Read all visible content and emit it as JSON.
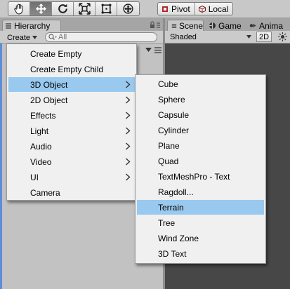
{
  "toolbar": {
    "tools": [
      {
        "icon": "hand-icon",
        "active": false
      },
      {
        "icon": "move-icon",
        "active": true
      },
      {
        "icon": "rotate-icon",
        "active": false
      },
      {
        "icon": "scale-icon",
        "active": false
      },
      {
        "icon": "rect-icon",
        "active": false
      },
      {
        "icon": "transform-icon",
        "active": false
      }
    ],
    "pivot_label": "Pivot",
    "local_label": "Local"
  },
  "hierarchy": {
    "tab_label": "Hierarchy",
    "create_label": "Create",
    "search_placeholder": "All"
  },
  "scene": {
    "tabs": [
      {
        "label": "Scene",
        "icon": "scene-icon",
        "active": true
      },
      {
        "label": "Game",
        "icon": "game-icon",
        "active": false
      },
      {
        "label": "Anima",
        "icon": "animation-icon",
        "active": false
      }
    ],
    "shading_mode": "Shaded",
    "mode_2d_label": "2D"
  },
  "create_menu": {
    "items": [
      {
        "label": "Create Empty",
        "submenu": false,
        "highlighted": false
      },
      {
        "label": "Create Empty Child",
        "submenu": false,
        "highlighted": false
      },
      {
        "label": "3D Object",
        "submenu": true,
        "highlighted": true
      },
      {
        "label": "2D Object",
        "submenu": true,
        "highlighted": false
      },
      {
        "label": "Effects",
        "submenu": true,
        "highlighted": false
      },
      {
        "label": "Light",
        "submenu": true,
        "highlighted": false
      },
      {
        "label": "Audio",
        "submenu": true,
        "highlighted": false
      },
      {
        "label": "Video",
        "submenu": true,
        "highlighted": false
      },
      {
        "label": "UI",
        "submenu": true,
        "highlighted": false
      },
      {
        "label": "Camera",
        "submenu": false,
        "highlighted": false
      }
    ]
  },
  "object_submenu": {
    "items": [
      {
        "label": "Cube",
        "highlighted": false
      },
      {
        "label": "Sphere",
        "highlighted": false
      },
      {
        "label": "Capsule",
        "highlighted": false
      },
      {
        "label": "Cylinder",
        "highlighted": false
      },
      {
        "label": "Plane",
        "highlighted": false
      },
      {
        "label": "Quad",
        "highlighted": false
      },
      {
        "label": "TextMeshPro - Text",
        "highlighted": false
      },
      {
        "label": "Ragdoll...",
        "highlighted": false
      },
      {
        "label": "Terrain",
        "highlighted": true
      },
      {
        "label": "Tree",
        "highlighted": false
      },
      {
        "label": "Wind Zone",
        "highlighted": false
      },
      {
        "label": "3D Text",
        "highlighted": false
      }
    ]
  },
  "colors": {
    "highlight": "#99c9ef",
    "menu_bg": "#f0f0f0",
    "scene_bg": "#474747",
    "panel_bg": "#c2c2c2"
  }
}
